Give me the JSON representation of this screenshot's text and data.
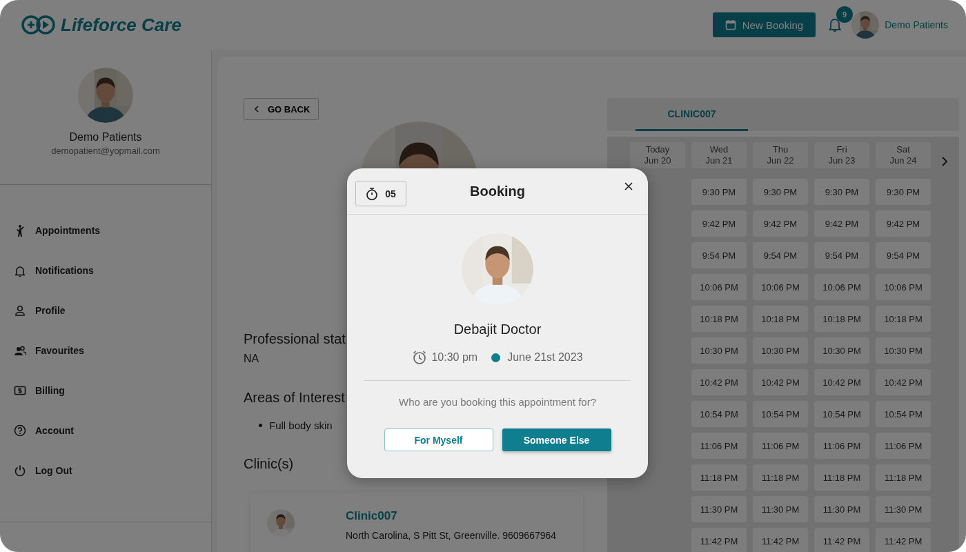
{
  "header": {
    "logo": "Lifeforce Care",
    "new_booking_button": "New Booking",
    "notification_count": "9",
    "user_name": "Demo Patients"
  },
  "sidebar": {
    "profile": {
      "name": "Demo Patients",
      "email": "demopatient@yopmail.com"
    },
    "items": [
      {
        "label": "Appointments"
      },
      {
        "label": "Notifications"
      },
      {
        "label": "Profile"
      },
      {
        "label": "Favourites"
      },
      {
        "label": "Billing"
      },
      {
        "label": "Account"
      },
      {
        "label": "Log Out"
      }
    ]
  },
  "main": {
    "back_button": "GO BACK",
    "professional_statement": {
      "heading": "Professional stat",
      "value": "NA"
    },
    "areas_of_interest": {
      "heading": "Areas of Interest",
      "items": [
        "Full body skin"
      ]
    },
    "clinics": {
      "heading": "Clinic(s)",
      "items": [
        {
          "name": "Clinic007",
          "address": "North Carolina, S Pitt St, Greenville. 9609667964"
        }
      ]
    }
  },
  "calendar": {
    "tabs": [
      {
        "label": "CLINIC007",
        "selected": true
      }
    ],
    "days": [
      {
        "day": "Today",
        "date": "Jun 20"
      },
      {
        "day": "Wed",
        "date": "Jun 21",
        "slots": [
          "9:30 PM",
          "9:42 PM",
          "9:54 PM",
          "10:06 PM",
          "10:18 PM",
          "10:30 PM",
          "10:42 PM",
          "10:54 PM",
          "11:06 PM",
          "11:18 PM",
          "11:30 PM",
          "11:42 PM"
        ]
      },
      {
        "day": "Thu",
        "date": "Jun 22",
        "slots": [
          "9:30 PM",
          "9:42 PM",
          "9:54 PM",
          "10:06 PM",
          "10:18 PM",
          "10:30 PM",
          "10:42 PM",
          "10:54 PM",
          "11:06 PM",
          "11:18 PM",
          "11:30 PM",
          "11:42 PM"
        ]
      },
      {
        "day": "Fri",
        "date": "Jun 23",
        "slots": [
          "9:30 PM",
          "9:42 PM",
          "9:54 PM",
          "10:06 PM",
          "10:18 PM",
          "10:30 PM",
          "10:42 PM",
          "10:54 PM",
          "11:06 PM",
          "11:18 PM",
          "11:30 PM",
          "11:42 PM"
        ]
      },
      {
        "day": "Sat",
        "date": "Jun 24",
        "slots": [
          "9:30 PM",
          "9:42 PM",
          "9:54 PM",
          "10:06 PM",
          "10:18 PM",
          "10:30 PM",
          "10:42 PM",
          "10:54 PM",
          "11:06 PM",
          "11:18 PM",
          "11:30 PM",
          "11:42 PM"
        ]
      }
    ]
  },
  "modal": {
    "timer": "05",
    "title": "Booking",
    "doctor_name": "Debajit Doctor",
    "time": "10:30 pm",
    "date": "June 21st 2023",
    "question": "Who are you booking this appointment for?",
    "buttons": [
      {
        "label": "For Myself",
        "kind": "outline"
      },
      {
        "label": "Someone Else",
        "kind": "primary"
      }
    ]
  }
}
